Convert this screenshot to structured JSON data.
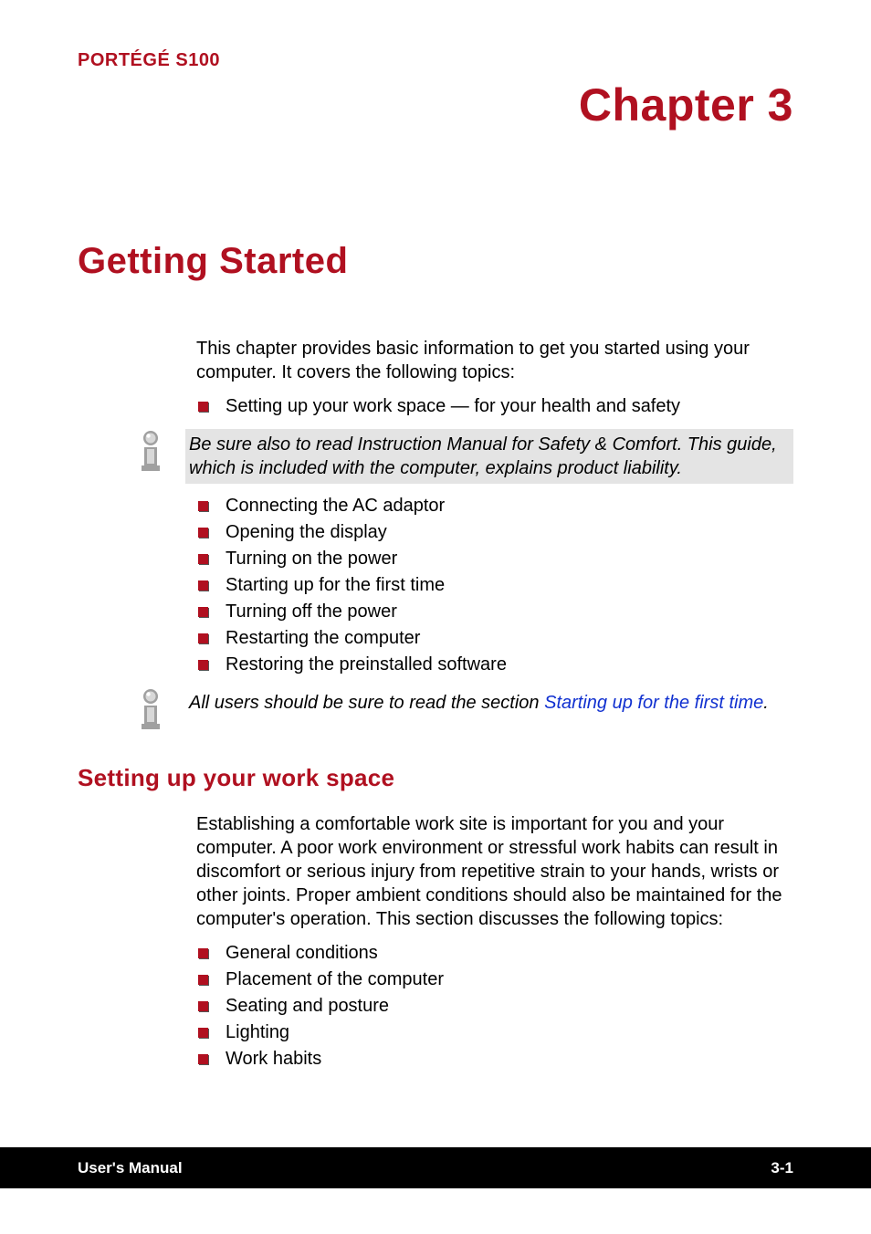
{
  "header": {
    "product": "PORTÉGÉ S100",
    "chapter_number": "Chapter 3",
    "chapter_title": "Getting Started"
  },
  "intro": {
    "paragraph": "This chapter provides basic information to get you started using your computer. It covers the following topics:",
    "bullets1": [
      "Setting up your work space — for your health and safety"
    ],
    "note1": "Be sure also to read Instruction Manual for Safety & Comfort. This guide, which is included with the computer, explains product liability.",
    "bullets2": [
      "Connecting the AC adaptor",
      "Opening the display",
      "Turning on the power",
      "Starting up for the first time",
      "Turning off the power",
      "Restarting the computer",
      "Restoring the preinstalled software"
    ],
    "note2_prefix": "All users should be sure to read the section ",
    "note2_link": "Starting up for the first time",
    "note2_suffix": "."
  },
  "section1": {
    "heading": "Setting up your work space",
    "paragraph": "Establishing a comfortable work site is important for you and your computer. A poor work environment or stressful work habits can result in discomfort or serious injury from repetitive strain to your hands, wrists or other joints. Proper ambient conditions should also be maintained for the computer's operation. This section discusses the following topics:",
    "bullets": [
      "General conditions",
      "Placement of the computer",
      "Seating and posture",
      "Lighting",
      "Work habits"
    ]
  },
  "footer": {
    "left": "User's Manual",
    "right": "3-1"
  }
}
